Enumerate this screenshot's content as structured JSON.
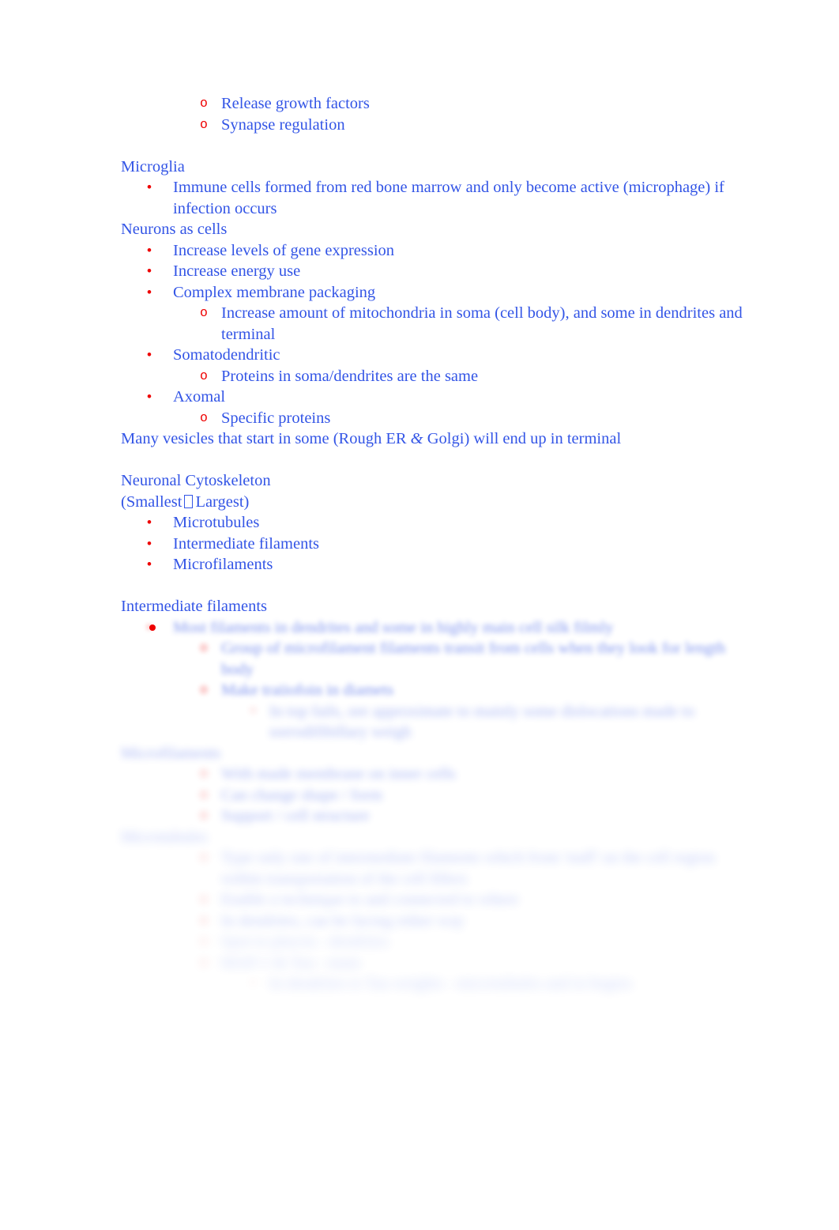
{
  "document": {
    "text_color": "#3355e6",
    "marker_color": "#ee0000",
    "background": "#ffffff",
    "blocks": [
      {
        "type": "item",
        "level": 2,
        "marker": "o",
        "text": "Release growth factors"
      },
      {
        "type": "item",
        "level": 2,
        "marker": "o",
        "text": "Synapse regulation"
      },
      {
        "type": "blank",
        "text": ""
      },
      {
        "type": "heading",
        "text": "Microglia"
      },
      {
        "type": "item",
        "level": 1,
        "marker": "•",
        "text": "Immune cells formed from red bone marrow and only become active (microphage) if infection occurs"
      },
      {
        "type": "heading",
        "text": "Neurons as cells"
      },
      {
        "type": "item",
        "level": 1,
        "marker": "•",
        "text": "Increase levels of gene expression"
      },
      {
        "type": "item",
        "level": 1,
        "marker": "•",
        "text": "Increase energy use"
      },
      {
        "type": "item",
        "level": 1,
        "marker": "•",
        "text": "Complex membrane packaging"
      },
      {
        "type": "item",
        "level": 2,
        "marker": "o",
        "text": "Increase amount of mitochondria in soma (cell body), and some in dendrites and terminal"
      },
      {
        "type": "item",
        "level": 1,
        "marker": "•",
        "text": "Somatodendritic"
      },
      {
        "type": "item",
        "level": 2,
        "marker": "o",
        "text": "Proteins in soma/dendrites are the same"
      },
      {
        "type": "item",
        "level": 1,
        "marker": "•",
        "text": "Axomal"
      },
      {
        "type": "item",
        "level": 2,
        "marker": "o",
        "text": "Specific proteins"
      },
      {
        "type": "heading",
        "text": "Many vesicles that start in some (Rough ER & Golgi) will end up in terminal"
      },
      {
        "type": "blank",
        "text": ""
      },
      {
        "type": "heading",
        "text": "Neuronal Cytoskeleton"
      },
      {
        "type": "heading",
        "text": "(Smallest ❑ Largest)"
      },
      {
        "type": "item",
        "level": 1,
        "marker": "•",
        "text": "Microtubules"
      },
      {
        "type": "item",
        "level": 1,
        "marker": "•",
        "text": "Intermediate filaments"
      },
      {
        "type": "item",
        "level": 1,
        "marker": "•",
        "text": "Microfilaments"
      },
      {
        "type": "blank",
        "text": ""
      },
      {
        "type": "heading",
        "text": "Intermediate filaments"
      }
    ],
    "line1": "Release growth factors",
    "line2": "Synapse regulation",
    "microglia_heading": "Microglia",
    "microglia_item": "Immune cells formed from red bone marrow and only become active (microphage) if infection occurs",
    "neurons_heading": "Neurons as cells",
    "neurons_item1": "Increase levels of gene expression",
    "neurons_item2": "Increase energy use",
    "neurons_item3": "Complex membrane packaging",
    "neurons_sub1": "Increase amount of mitochondria in soma (cell body), and some in dendrites and terminal",
    "neurons_item4": "Somatodendritic",
    "neurons_sub2": "Proteins in soma/dendrites are the same",
    "neurons_item5": "Axomal",
    "neurons_sub3": "Specific proteins",
    "vesicles_line_a": "Many vesicles that start in some (Rough ER ",
    "vesicles_amp": "&",
    "vesicles_line_b": " Golgi) will end up in terminal",
    "cytoskeleton_heading": "Neuronal Cytoskeleton",
    "cytoskeleton_order_a": "(Smallest",
    "cytoskeleton_order_b": "Largest)",
    "cytoskeleton_item1": "Microtubules",
    "cytoskeleton_item2": "Intermediate filaments",
    "cytoskeleton_item3": "Microfilaments",
    "intermediate_heading": "Intermediate filaments"
  },
  "markers": {
    "bullet": "•",
    "circle": "o",
    "square": "▪"
  },
  "redacted": {
    "note": "blurred-illegible",
    "blocks": [
      {
        "level": 1,
        "marker": "•",
        "text": "Most filaments in dendrites and some in highly main cell silk filmly",
        "blur": 1
      },
      {
        "level": 2,
        "marker": "o",
        "text": "Group of microfilament filaments transit from cells when they look for length body",
        "blur": 1
      },
      {
        "level": 2,
        "marker": "o",
        "text": "Make traiiofoin in diamets",
        "blur": 1
      },
      {
        "level": 3,
        "marker": "▪",
        "text": "In top fails, ore approximate to mainly some dislocations made to sorrodifibillary weigh",
        "blur": 2
      },
      {
        "heading": true,
        "text": "Microfilaments",
        "blur": 2
      },
      {
        "level": 2,
        "marker": "o",
        "text": "With made membrane on inner cells",
        "blur": 2
      },
      {
        "level": 2,
        "marker": "o",
        "text": "Can change shape / form",
        "blur": 2
      },
      {
        "level": 2,
        "marker": "o",
        "text": "Support / cell structure",
        "blur": 2
      },
      {
        "heading": true,
        "text": "Microtubules",
        "blur": 3
      },
      {
        "level": 2,
        "marker": "o",
        "text": "Type only one of intermediate filaments which from 'staff' on the cell region within transportation of the cell fillers",
        "blur": 3
      },
      {
        "level": 2,
        "marker": "o",
        "text": "Enable a technique to and connected to where",
        "blur": 3
      },
      {
        "level": 2,
        "marker": "o",
        "text": "In dendrites, can be facing either way",
        "blur": 3
      },
      {
        "level": 2,
        "marker": "o",
        "text": "Spot to plus/in - dendrites",
        "blur": 4
      },
      {
        "level": 2,
        "marker": "o",
        "text": "MAP-1 & Tau - main",
        "blur": 4
      },
      {
        "level": 3,
        "marker": "▪",
        "text": "In dendrites is Tau weights - microtubules and in begins",
        "blur": 4
      }
    ]
  }
}
